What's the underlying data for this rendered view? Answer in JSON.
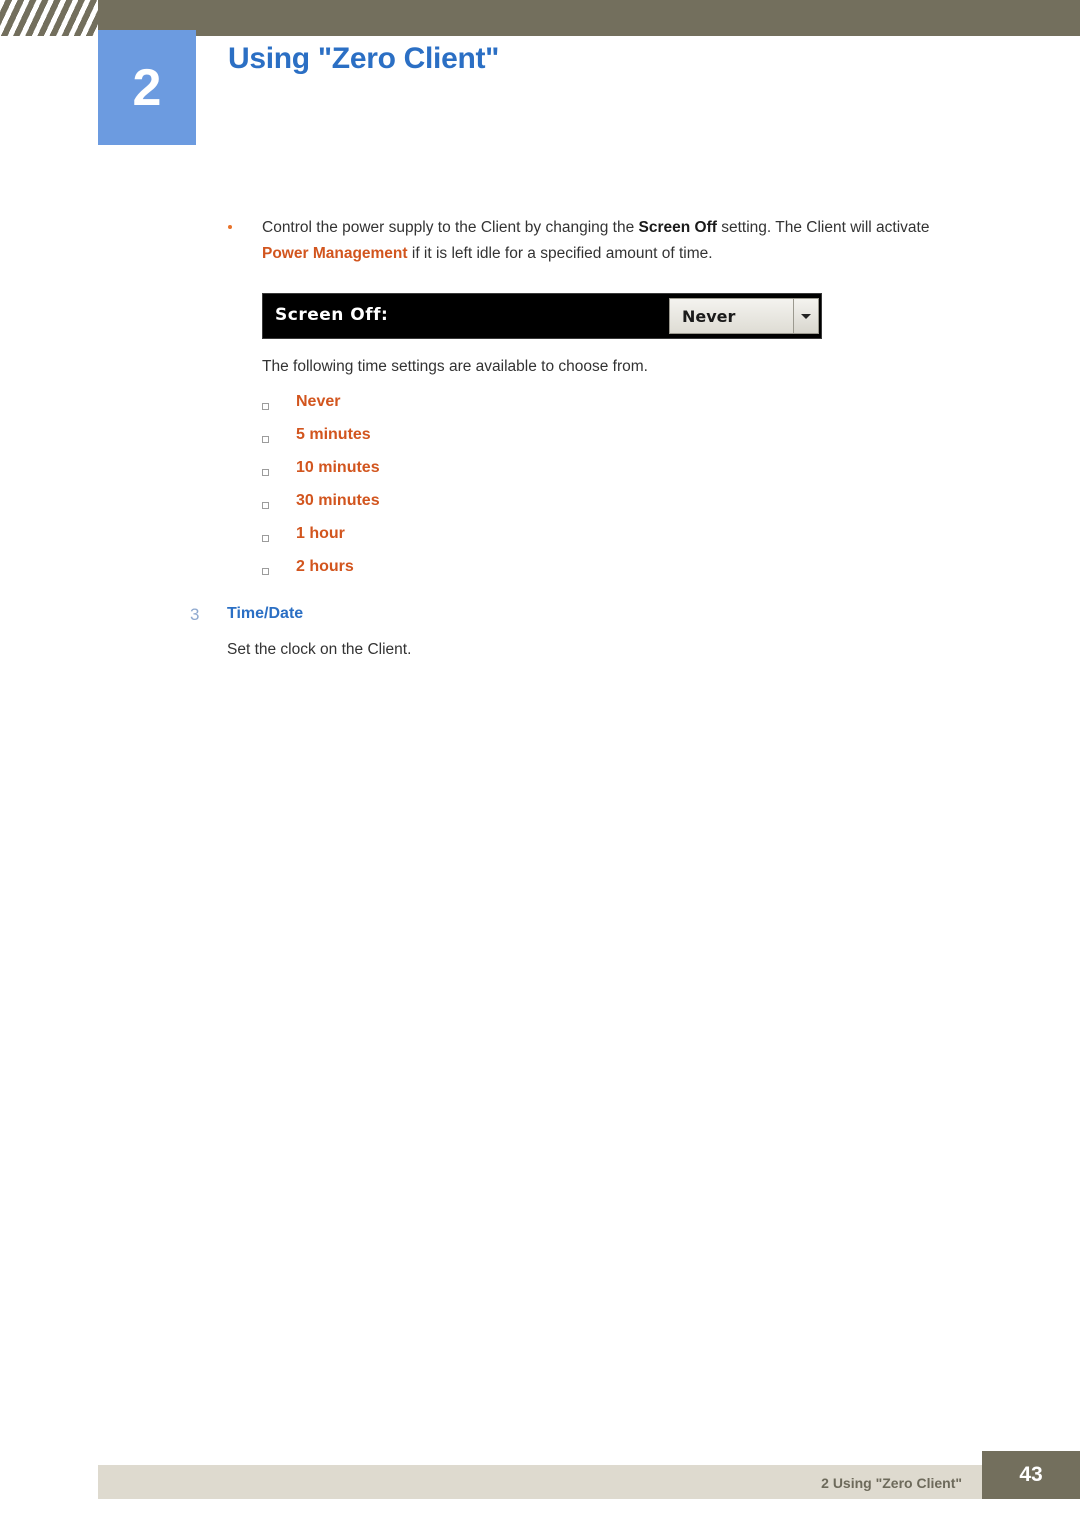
{
  "header": {
    "chapter_number": "2",
    "chapter_title": "Using \"Zero Client\""
  },
  "content": {
    "bullet": {
      "text_part1": "Control the power supply to the Client by changing the ",
      "keyword1": "Screen Off",
      "text_part2": " setting. The Client will activate ",
      "keyword2": "Power Management",
      "text_part3": " if it is left idle for a specified amount of time."
    },
    "osd": {
      "label": "Screen Off:",
      "selected_value": "Never",
      "arrow_icon": "chevron-down-icon"
    },
    "sub_paragraph": "The following time settings are available to choose from.",
    "options": [
      {
        "label": "Never"
      },
      {
        "label": "5 minutes"
      },
      {
        "label": "10 minutes"
      },
      {
        "label": "30 minutes"
      },
      {
        "label": "1 hour"
      },
      {
        "label": "2 hours"
      }
    ],
    "step": {
      "number": "3",
      "label": "Time/Date",
      "description": "Set the clock on the Client."
    }
  },
  "footer": {
    "text": "2 Using \"Zero Client\"",
    "page_number": "43"
  },
  "colors": {
    "header_bar": "#736f5d",
    "chapter_badge": "#6c9be0",
    "title_blue": "#2b6fc4",
    "accent_orange": "#d2551e",
    "footer_bar": "#dedacf"
  }
}
